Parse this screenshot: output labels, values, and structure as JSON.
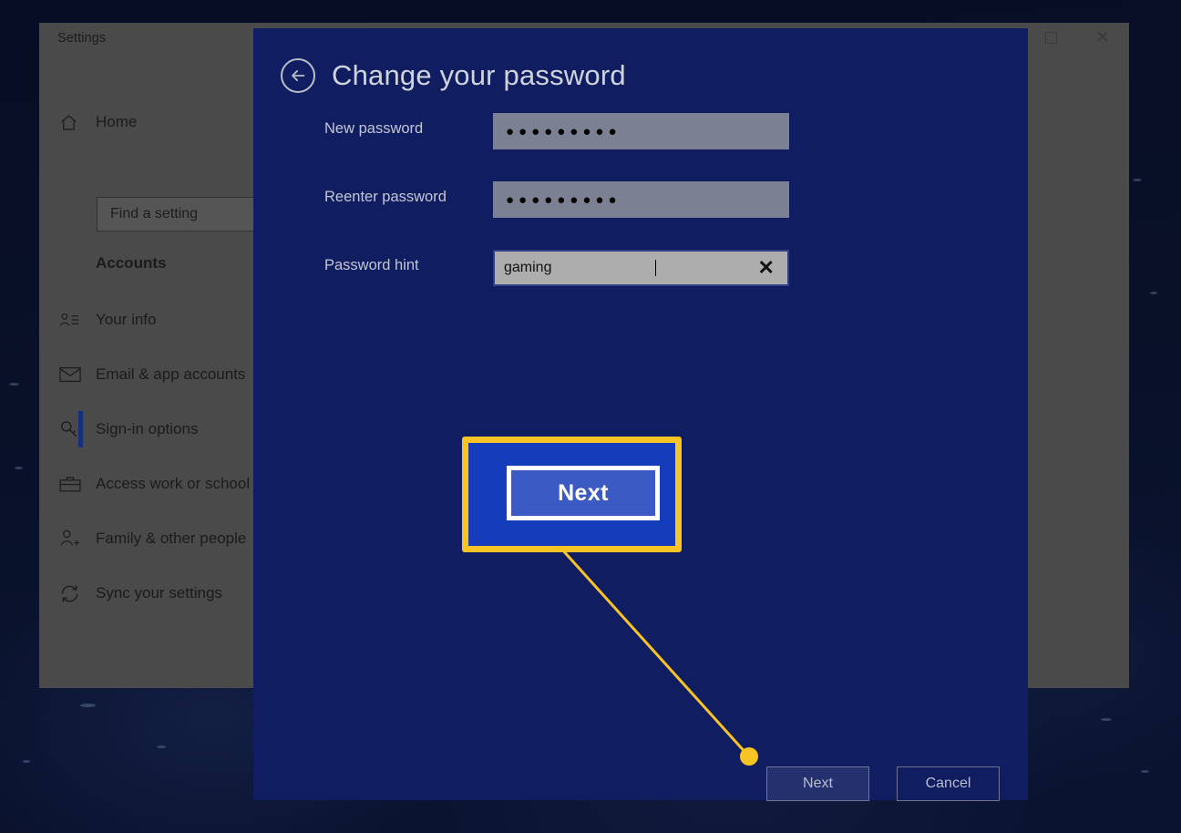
{
  "desktop": {
    "background_color": "#091129"
  },
  "settings_window": {
    "title": "Settings",
    "controls": {
      "maximize": "maximize-icon",
      "close": "close-icon"
    },
    "nav": {
      "home": {
        "label": "Home",
        "icon": "home-icon"
      },
      "search": {
        "placeholder": "Find a setting",
        "icon": "search-input"
      },
      "section_header": "Accounts",
      "items": [
        {
          "label": "Your info",
          "icon": "user-card-icon",
          "selected": false
        },
        {
          "label": "Email & app accounts",
          "icon": "envelope-icon",
          "selected": false
        },
        {
          "label": "Sign-in options",
          "icon": "key-icon",
          "selected": true
        },
        {
          "label": "Access work or school",
          "icon": "briefcase-icon",
          "selected": false
        },
        {
          "label": "Family & other people",
          "icon": "person-add-icon",
          "selected": false
        },
        {
          "label": "Sync your settings",
          "icon": "sync-icon",
          "selected": false
        }
      ]
    }
  },
  "dialog": {
    "title": "Change your password",
    "back_icon": "back-arrow-icon",
    "accent_color": "#111d61",
    "fields": [
      {
        "label": "New password",
        "value": "●●●●●●●●●",
        "type": "password",
        "focused": false
      },
      {
        "label": "Reenter password",
        "value": "●●●●●●●●●",
        "type": "password",
        "focused": false
      },
      {
        "label": "Password hint",
        "value": "gaming",
        "type": "text",
        "focused": true,
        "clear_icon": "✕"
      }
    ],
    "buttons": {
      "next": "Next",
      "cancel": "Cancel"
    }
  },
  "callout": {
    "label": "Next",
    "highlight_color": "#f7c325",
    "button_color": "#3c5ac4",
    "panel_color": "#153dbb",
    "line_color": "#f7c325"
  }
}
